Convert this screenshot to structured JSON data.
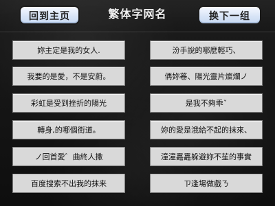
{
  "header": {
    "left_button": "回到主页",
    "title": "繁体字网名",
    "right_button": "换下一组"
  },
  "grid": {
    "left": [
      "妳主定是我的女人.",
      "我要的是愛，不是安蔚。",
      "彩虹是受到挫折的陽光",
      "轉身,的哪個街道。",
      "ノ回首愛゛曲終人撒",
      "百度搜索不出我的抹来"
    ],
    "right": [
      "汾手說的哪麼輕巧、",
      "侢妳菤、陽光靈片燦爛ノ",
      "是我不夠乖ˇ",
      "妳的愛是涐給不起的抹來、",
      "潼潼靐靐躲避妳不苼的事實",
      "ㄗ逢場做戲ㄋ"
    ]
  }
}
